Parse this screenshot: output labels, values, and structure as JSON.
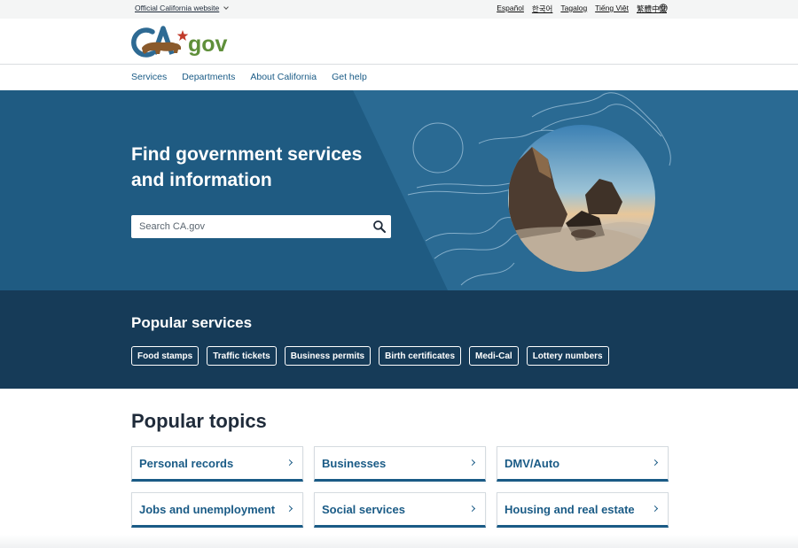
{
  "utility": {
    "official_label": "Official California website",
    "languages": [
      "Español",
      "한국어",
      "Tagalog",
      "Tiếng Việt",
      "繁體中文"
    ],
    "globe_icon": "globe-icon"
  },
  "logo": {
    "prefix": "CA",
    "suffix": "gov"
  },
  "nav": {
    "items": [
      "Services",
      "Departments",
      "About California",
      "Get help"
    ]
  },
  "hero": {
    "title": "Find government services and information",
    "search_placeholder": "Search CA.gov",
    "search_icon": "search-icon"
  },
  "services": {
    "title": "Popular services",
    "items": [
      "Food stamps",
      "Traffic tickets",
      "Business permits",
      "Birth certificates",
      "Medi-Cal",
      "Lottery numbers"
    ]
  },
  "topics": {
    "title": "Popular topics",
    "items": [
      "Personal records",
      "Businesses",
      "DMV/Auto",
      "Jobs and unemployment",
      "Social services",
      "Housing and real estate"
    ]
  },
  "colors": {
    "accent": "#1a5b86",
    "hero_bg": "#1f5b82",
    "services_bg": "#163b58",
    "logo_red": "#c13a2a",
    "logo_green": "#5f8f3a",
    "logo_blue": "#2e6a93"
  }
}
